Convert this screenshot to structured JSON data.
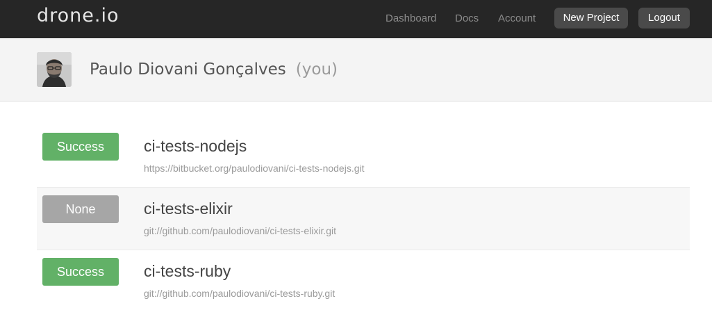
{
  "app": {
    "logo_text": "drone.io"
  },
  "nav": {
    "links": [
      {
        "label": "Dashboard"
      },
      {
        "label": "Docs"
      },
      {
        "label": "Account"
      }
    ],
    "new_project_label": "New Project",
    "logout_label": "Logout"
  },
  "profile": {
    "name": "Paulo Diovani Gonçalves",
    "you_label": "(you)"
  },
  "colors": {
    "success": "#62b167",
    "none": "#a6a6a6",
    "navbar": "#262626"
  },
  "repos": [
    {
      "status": "Success",
      "name": "ci-tests-nodejs",
      "url": "https://bitbucket.org/paulodiovani/ci-tests-nodejs.git"
    },
    {
      "status": "None",
      "name": "ci-tests-elixir",
      "url": "git://github.com/paulodiovani/ci-tests-elixir.git"
    },
    {
      "status": "Success",
      "name": "ci-tests-ruby",
      "url": "git://github.com/paulodiovani/ci-tests-ruby.git"
    }
  ]
}
